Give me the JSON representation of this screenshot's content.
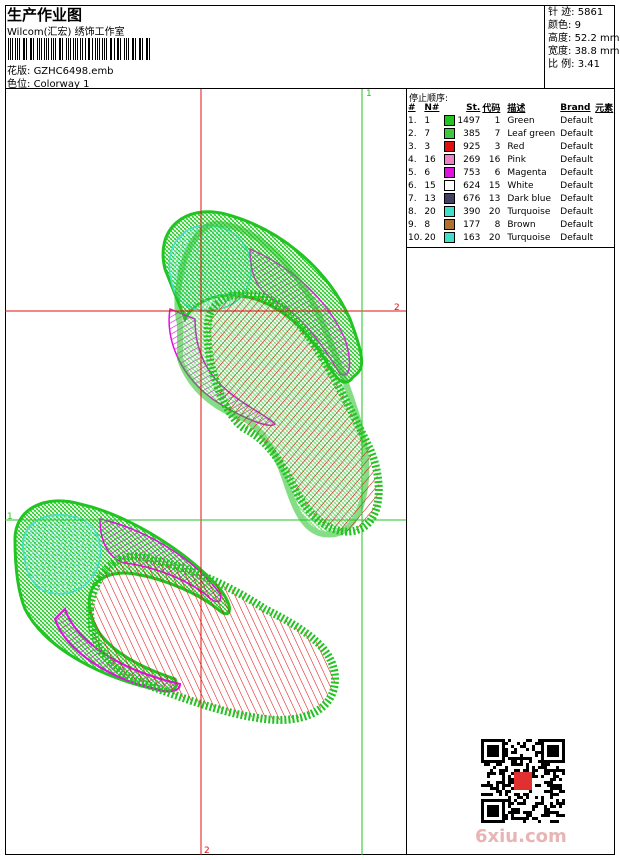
{
  "header": {
    "title": "生产作业图",
    "company": "Wilcom(汇宏) 绣饰工作室",
    "file_label": "花版:",
    "file_name": "GZHC6498.emb",
    "colorway_label": "色位:",
    "colorway": "Colorway 1"
  },
  "stats": [
    {
      "label": "针 迹:",
      "value": "5861"
    },
    {
      "label": "颜色:",
      "value": "9"
    },
    {
      "label": "高度:",
      "value": "52.2 mm"
    },
    {
      "label": "宽度:",
      "value": "38.8 mm"
    },
    {
      "label": "比 例:",
      "value": "3.41"
    }
  ],
  "stop_sequence": {
    "title": "停止顺序:",
    "columns": [
      "#",
      "N#",
      "St.",
      "代码",
      "描述",
      "Brand",
      "元素"
    ],
    "rows": [
      {
        "idx": "1.",
        "n": "1",
        "color": "#22c422",
        "st": "1497",
        "code": "1",
        "desc": "Green",
        "brand": "Default"
      },
      {
        "idx": "2.",
        "n": "7",
        "color": "#3ec83e",
        "st": "385",
        "code": "7",
        "desc": "Leaf green",
        "brand": "Default"
      },
      {
        "idx": "3.",
        "n": "3",
        "color": "#e01010",
        "st": "925",
        "code": "3",
        "desc": "Red",
        "brand": "Default"
      },
      {
        "idx": "4.",
        "n": "16",
        "color": "#f080c8",
        "st": "269",
        "code": "16",
        "desc": "Pink",
        "brand": "Default"
      },
      {
        "idx": "5.",
        "n": "6",
        "color": "#e010e0",
        "st": "753",
        "code": "6",
        "desc": "Magenta",
        "brand": "Default"
      },
      {
        "idx": "6.",
        "n": "15",
        "color": "#ffffff",
        "st": "624",
        "code": "15",
        "desc": "White",
        "brand": "Default"
      },
      {
        "idx": "7.",
        "n": "13",
        "color": "#404060",
        "st": "676",
        "code": "13",
        "desc": "Dark blue",
        "brand": "Default"
      },
      {
        "idx": "8.",
        "n": "20",
        "color": "#40e0c8",
        "st": "390",
        "code": "20",
        "desc": "Turquoise",
        "brand": "Default"
      },
      {
        "idx": "9.",
        "n": "8",
        "color": "#b07030",
        "st": "177",
        "code": "8",
        "desc": "Brown",
        "brand": "Default"
      },
      {
        "idx": "10.",
        "n": "20",
        "color": "#40e0c8",
        "st": "163",
        "code": "20",
        "desc": "Turquoise",
        "brand": "Default"
      }
    ]
  },
  "guides": {
    "labels": [
      "1",
      "2",
      "1",
      "2"
    ]
  },
  "watermark": "6xiu.com"
}
